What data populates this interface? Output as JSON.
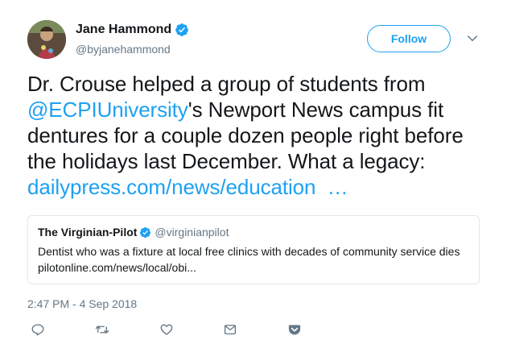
{
  "user": {
    "display_name": "Jane Hammond",
    "handle": "@byjanehammond"
  },
  "follow_label": "Follow",
  "tweet": {
    "text_1": "Dr. Crouse helped a group of students from ",
    "mention": "@ECPIUniversity",
    "text_2": "'s Newport News campus fit dentures for a couple dozen people right before the holidays last December. What a legacy: ",
    "link": "dailypress.com/news/education  …"
  },
  "quote": {
    "name": "The Virginian-Pilot",
    "handle": "@virginianpilot",
    "text": "Dentist who was a fixture at local free clinics with decades of community service dies",
    "link": "pilotonline.com/news/local/obi..."
  },
  "timestamp": "2:47 PM - 4 Sep 2018",
  "colors": {
    "accent": "#1da1f2",
    "secondary_text": "#657786",
    "border": "#e1e8ed"
  },
  "icons": [
    "verified-badge-icon",
    "chevron-down-icon",
    "reply-icon",
    "retweet-icon",
    "like-icon",
    "direct-message-icon",
    "pocket-icon"
  ]
}
